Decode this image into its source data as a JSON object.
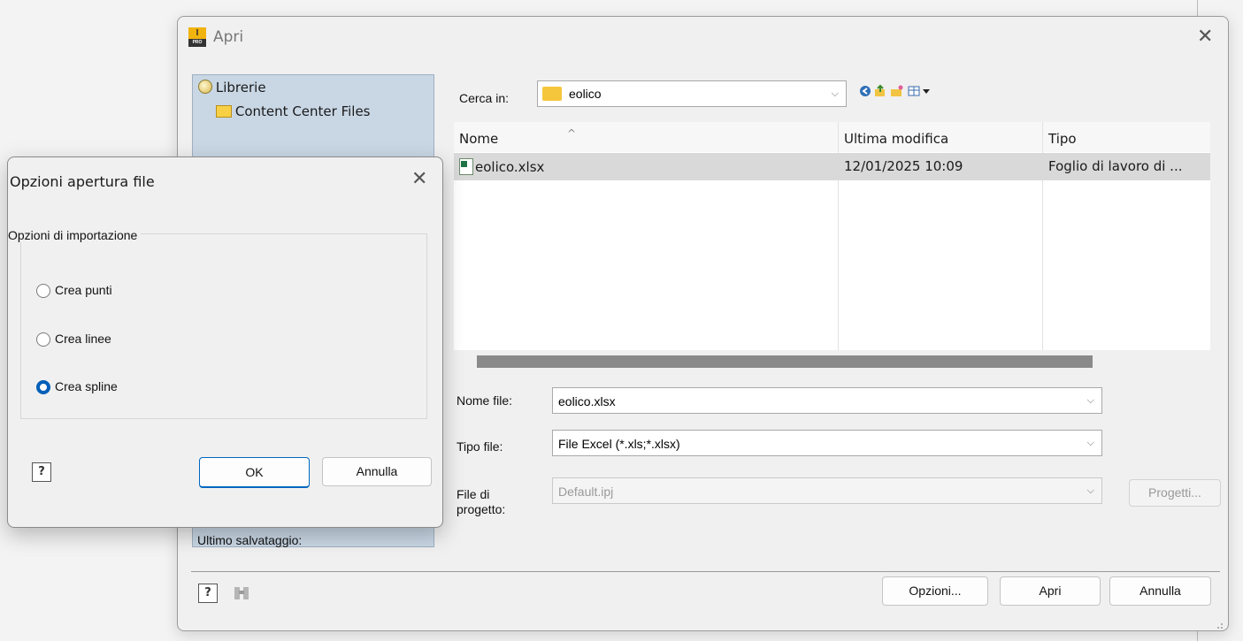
{
  "main_dialog": {
    "title": "Apri",
    "app_icon_text": "I",
    "app_icon_sub": "PRO",
    "close_glyph": "✕",
    "library": {
      "root_label": "Librerie",
      "child_label": "Content Center Files"
    },
    "look_in": {
      "label": "Cerca in:",
      "value": "eolico"
    },
    "toolbar_icons": [
      "back-icon",
      "up-folder-icon",
      "new-folder-icon",
      "view-menu-icon"
    ],
    "file_list": {
      "columns": [
        "Nome",
        "Ultima modifica",
        "Tipo"
      ],
      "rows": [
        {
          "name": "eolico.xlsx",
          "modified": "12/01/2025 10:09",
          "type": "Foglio di lavoro di ..."
        }
      ]
    },
    "file_name": {
      "label": "Nome file:",
      "value": "eolico.xlsx"
    },
    "file_type": {
      "label": "Tipo file:",
      "value": "File Excel (*.xls;*.xlsx)"
    },
    "project_file": {
      "label_line1": "File di",
      "label_line2": "progetto:",
      "value": "Default.ipj",
      "button": "Progetti..."
    },
    "last_saved_label": "Ultimo salvataggio:",
    "buttons": {
      "options": "Opzioni...",
      "open": "Apri",
      "cancel": "Annulla"
    }
  },
  "options_dialog": {
    "title": "Opzioni apertura file",
    "close_glyph": "✕",
    "group_label": "Opzioni di importazione",
    "options": [
      {
        "label": "Crea punti",
        "selected": false
      },
      {
        "label": "Crea linee",
        "selected": false
      },
      {
        "label": "Crea spline",
        "selected": true
      }
    ],
    "ok": "OK",
    "cancel": "Annulla"
  },
  "colors": {
    "accent": "#005fb8",
    "library_panel": "#c9d7e5",
    "selected_row": "#d9d9d9"
  }
}
